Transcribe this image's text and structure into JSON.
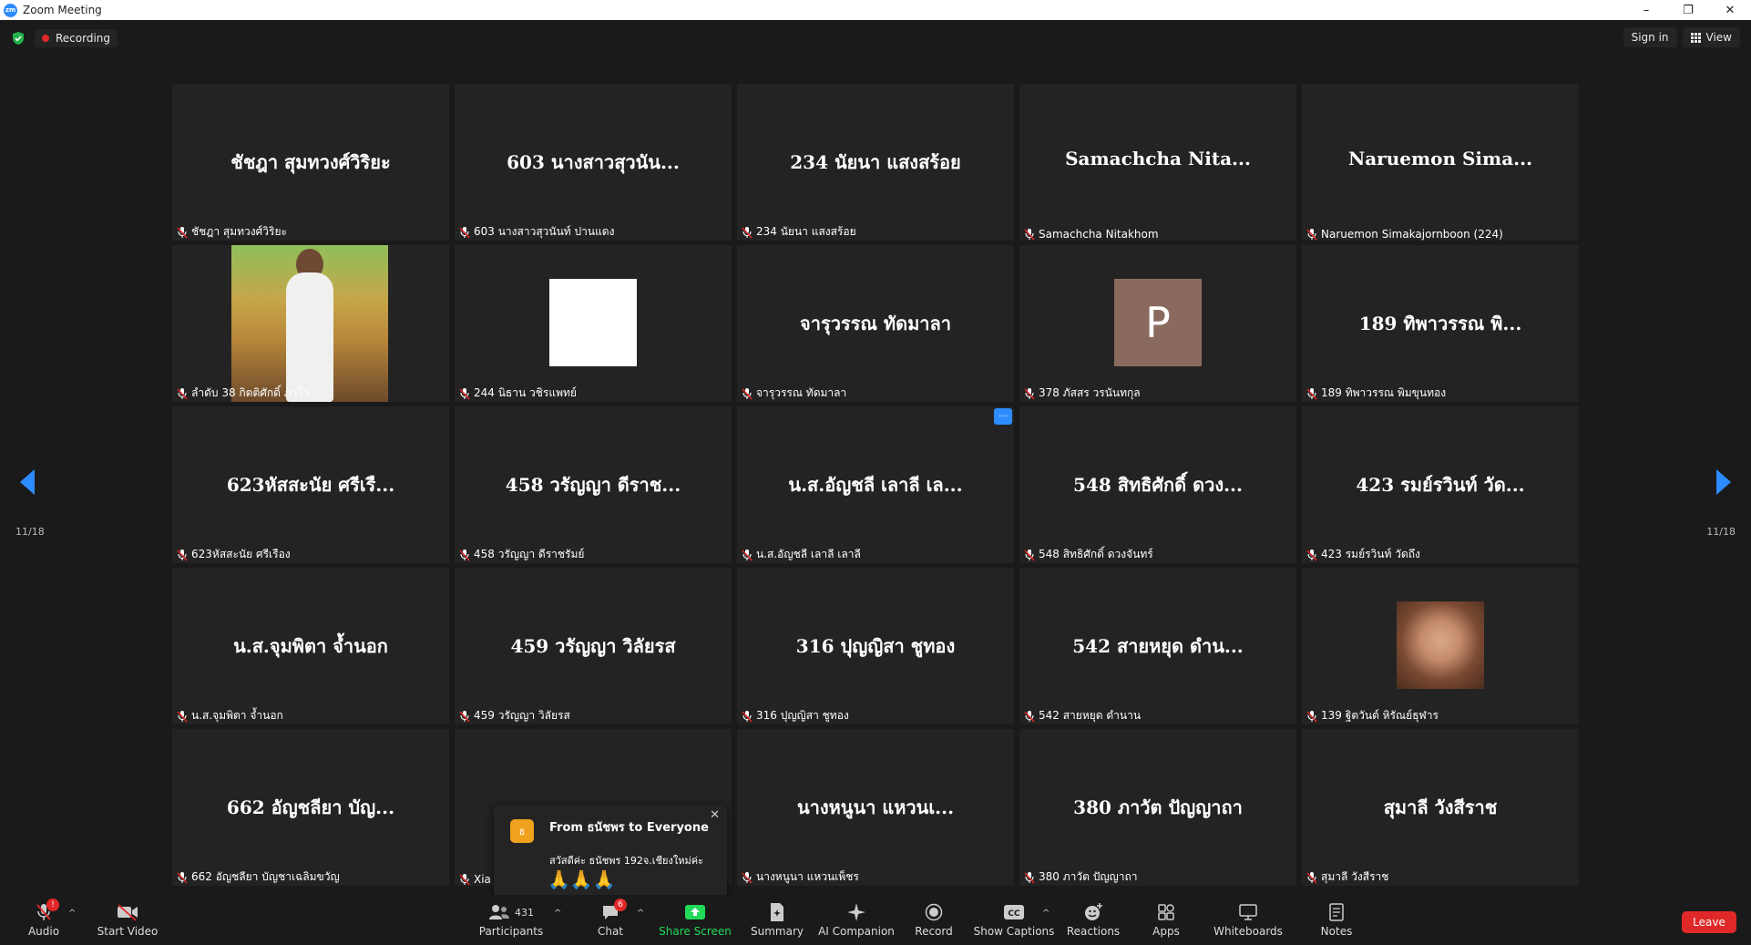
{
  "window": {
    "title": "Zoom Meeting",
    "logo_text": "zm",
    "minimize": "–",
    "restore": "❐",
    "close": "✕"
  },
  "topbar": {
    "recording_label": "Recording",
    "sign_in": "Sign in",
    "view": "View"
  },
  "pagination": {
    "left": "11/18",
    "right": "11/18"
  },
  "tiles": [
    {
      "big": "ชัชฎา สุมทวงศ์วิริยะ",
      "name": "ชัชฎา สุมทวงศ์วิริยะ",
      "kind": "text"
    },
    {
      "big": "603 นางสาวสุวนัน...",
      "name": "603 นางสาวสุวนันท์ ปานแดง",
      "kind": "text"
    },
    {
      "big": "234 นัยนา แสงสร้อย",
      "name": "234 นัยนา แสงสร้อย",
      "kind": "text"
    },
    {
      "big": "Samachcha Nita...",
      "name": "Samachcha Nitakhom",
      "kind": "text"
    },
    {
      "big": "Naruemon Sima...",
      "name": "Naruemon Simakajornboon (224)",
      "kind": "text"
    },
    {
      "big": "",
      "name": "ลำดับ 38 กิตติศักดิ์ ภาโว",
      "kind": "photo-man"
    },
    {
      "big": "",
      "name": "244 นิธาน วชิรแพทย์",
      "kind": "white"
    },
    {
      "big": "จารุวรรณ ทัดมาลา",
      "name": "จารุวรรณ ทัดมาลา",
      "kind": "text"
    },
    {
      "big": "",
      "name": "378 ภัสสร วรนันทกุล",
      "kind": "avatar",
      "avatar_letter": "P"
    },
    {
      "big": "189 ทิพาวรรณ พิ...",
      "name": "189 ทิพาวรรณ พิมขุนทอง",
      "kind": "text"
    },
    {
      "big": "623หัสสะนัย ศรีเรื...",
      "name": "623หัสสะนัย ศรีเรือง",
      "kind": "text"
    },
    {
      "big": "458 วรัญญา ดีราช...",
      "name": "458 วรัญญา ดีราชรัมย์",
      "kind": "text"
    },
    {
      "big": "น.ส.อัญชลี เลาลี เล...",
      "name": "น.ส.อัญชลี เลาลี เลาลี",
      "kind": "text",
      "more": "···"
    },
    {
      "big": "548 สิทธิศักดิ์ ดวง...",
      "name": "548 สิทธิศักดิ์ ดวงจันทร์",
      "kind": "text"
    },
    {
      "big": "423 รมย์รวินท์ วัด...",
      "name": "423 รมย์รวินท์ วัดถึง",
      "kind": "text"
    },
    {
      "big": "น.ส.จุมพิตา จ้ำนอก",
      "name": "น.ส.จุมพิตา จ้ำนอก",
      "kind": "text"
    },
    {
      "big": "459 วรัญญา วิลัยรส",
      "name": "459 วรัญญา วิลัยรส",
      "kind": "text"
    },
    {
      "big": "316 ปุญญิสา ชูทอง",
      "name": "316 ปุญญิสา ชูทอง",
      "kind": "text"
    },
    {
      "big": "542 สายหยุด ดำน...",
      "name": "542 สายหยุด ดำนาน",
      "kind": "text"
    },
    {
      "big": "",
      "name": "139 ฐิตวันต์ หิรัณย์ธุฬาร",
      "kind": "photo-woman"
    },
    {
      "big": "662 อัญชลียา บัญ...",
      "name": "662 อัญชลียา บัญชาเฉลิมขวัญ",
      "kind": "text"
    },
    {
      "big": "",
      "name": "Xia",
      "kind": "text"
    },
    {
      "big": "นางหนูนา แหวนเ...",
      "name": "นางหนูนา แหวนเพ็ชร",
      "kind": "text"
    },
    {
      "big": "380 ภาวัต ปัญญาถา",
      "name": "380 ภาวัต ปัญญาถา",
      "kind": "text"
    },
    {
      "big": "สุมาลี วังสีราช",
      "name": "สุมาลี วังสีราช",
      "kind": "text"
    }
  ],
  "chat_popup": {
    "avatar_letter": "ธ",
    "from": "From ธนัชพร to Everyone",
    "message": "สวัสดีค่ะ ธนัชพร 192จ.เชียงใหม่ค่ะ",
    "emoji": "🙏🙏🙏",
    "close": "✕"
  },
  "toolbar": {
    "audio": "Audio",
    "audio_badge": "!",
    "start_video": "Start Video",
    "participants": "Participants",
    "participants_count": "431",
    "chat": "Chat",
    "chat_badge": "6",
    "share_screen": "Share Screen",
    "summary": "Summary",
    "ai_companion": "AI Companion",
    "record": "Record",
    "show_captions": "Show Captions",
    "reactions": "Reactions",
    "apps": "Apps",
    "whiteboards": "Whiteboards",
    "notes": "Notes",
    "leave": "Leave",
    "caret": "^"
  },
  "colors": {
    "accent": "#2d8cff",
    "leave": "#e02828",
    "share": "#23d959"
  }
}
